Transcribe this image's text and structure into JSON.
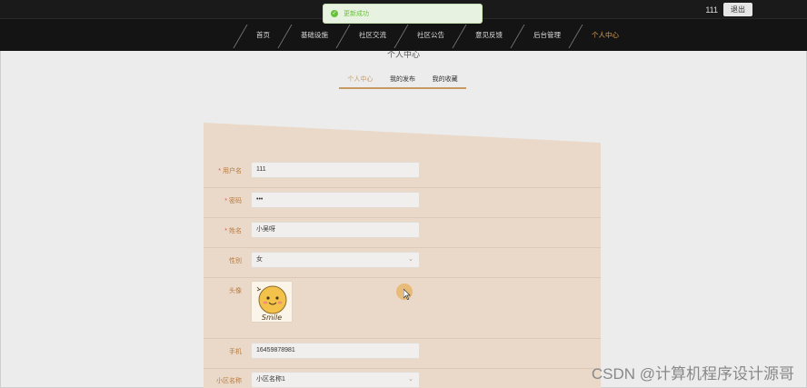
{
  "header": {
    "username": "111",
    "logout_label": "退出"
  },
  "toast": {
    "message": "更新成功"
  },
  "nav": {
    "items": [
      {
        "label": "首页"
      },
      {
        "label": "基础设施"
      },
      {
        "label": "社区交流"
      },
      {
        "label": "社区公告"
      },
      {
        "label": "意见反馈"
      },
      {
        "label": "后台管理"
      },
      {
        "label": "个人中心"
      }
    ]
  },
  "page": {
    "title": "个人中心"
  },
  "tabs": [
    {
      "label": "个人中心"
    },
    {
      "label": "我的发布"
    },
    {
      "label": "我的收藏"
    }
  ],
  "form": {
    "username": {
      "label": "用户名",
      "value": "111"
    },
    "password": {
      "label": "密码",
      "value": "•••"
    },
    "name": {
      "label": "姓名",
      "value": "小吴呀"
    },
    "gender": {
      "label": "性别",
      "value": "女"
    },
    "avatar": {
      "label": "头像",
      "caption": "Smile"
    },
    "phone": {
      "label": "手机",
      "value": "16459878981"
    },
    "community": {
      "label": "小区名称",
      "value": "小区名称1"
    }
  },
  "watermark": "CSDN @计算机程序设计源哥",
  "colors": {
    "accent": "#c89a62",
    "panel": "#ead9c9",
    "success": "#67c23a"
  }
}
